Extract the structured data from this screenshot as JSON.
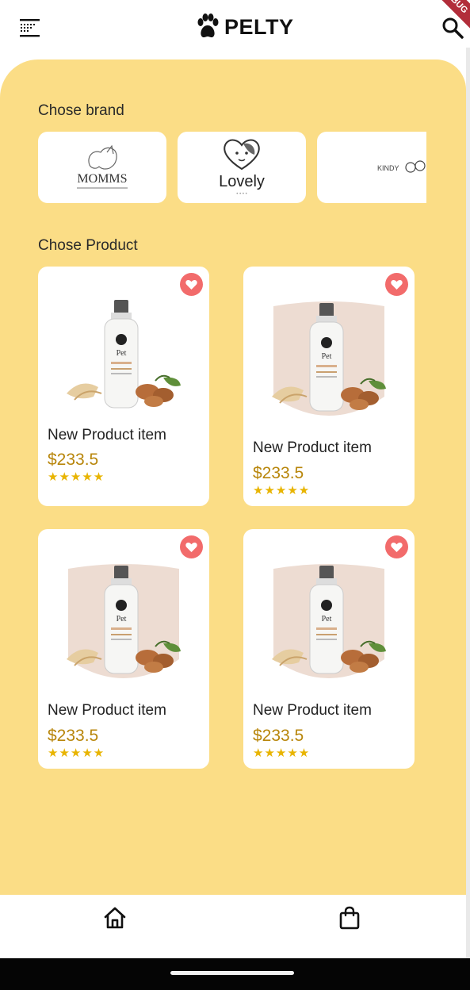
{
  "app": {
    "title": "PELTY",
    "debug_banner": "DEBUG"
  },
  "brands": {
    "title": "Chose brand",
    "items": [
      {
        "name": "MOMMS"
      },
      {
        "name": "Lovely"
      },
      {
        "name": "KINDY"
      }
    ]
  },
  "products": {
    "title": "Chose Product",
    "items": [
      {
        "name": "New Product item",
        "price": "$233.5",
        "rating": 5
      },
      {
        "name": "New Product item",
        "price": "$233.5",
        "rating": 5
      },
      {
        "name": "New Product item",
        "price": "$233.5",
        "rating": 5
      },
      {
        "name": "New Product item",
        "price": "$233.5",
        "rating": 5
      }
    ]
  },
  "colors": {
    "accent": "#fbdd86",
    "favorite": "#f26b6b",
    "price": "#b8860b",
    "star": "#e8b400"
  },
  "nav": {
    "items": [
      "home-icon",
      "shopping-bag-icon"
    ]
  }
}
